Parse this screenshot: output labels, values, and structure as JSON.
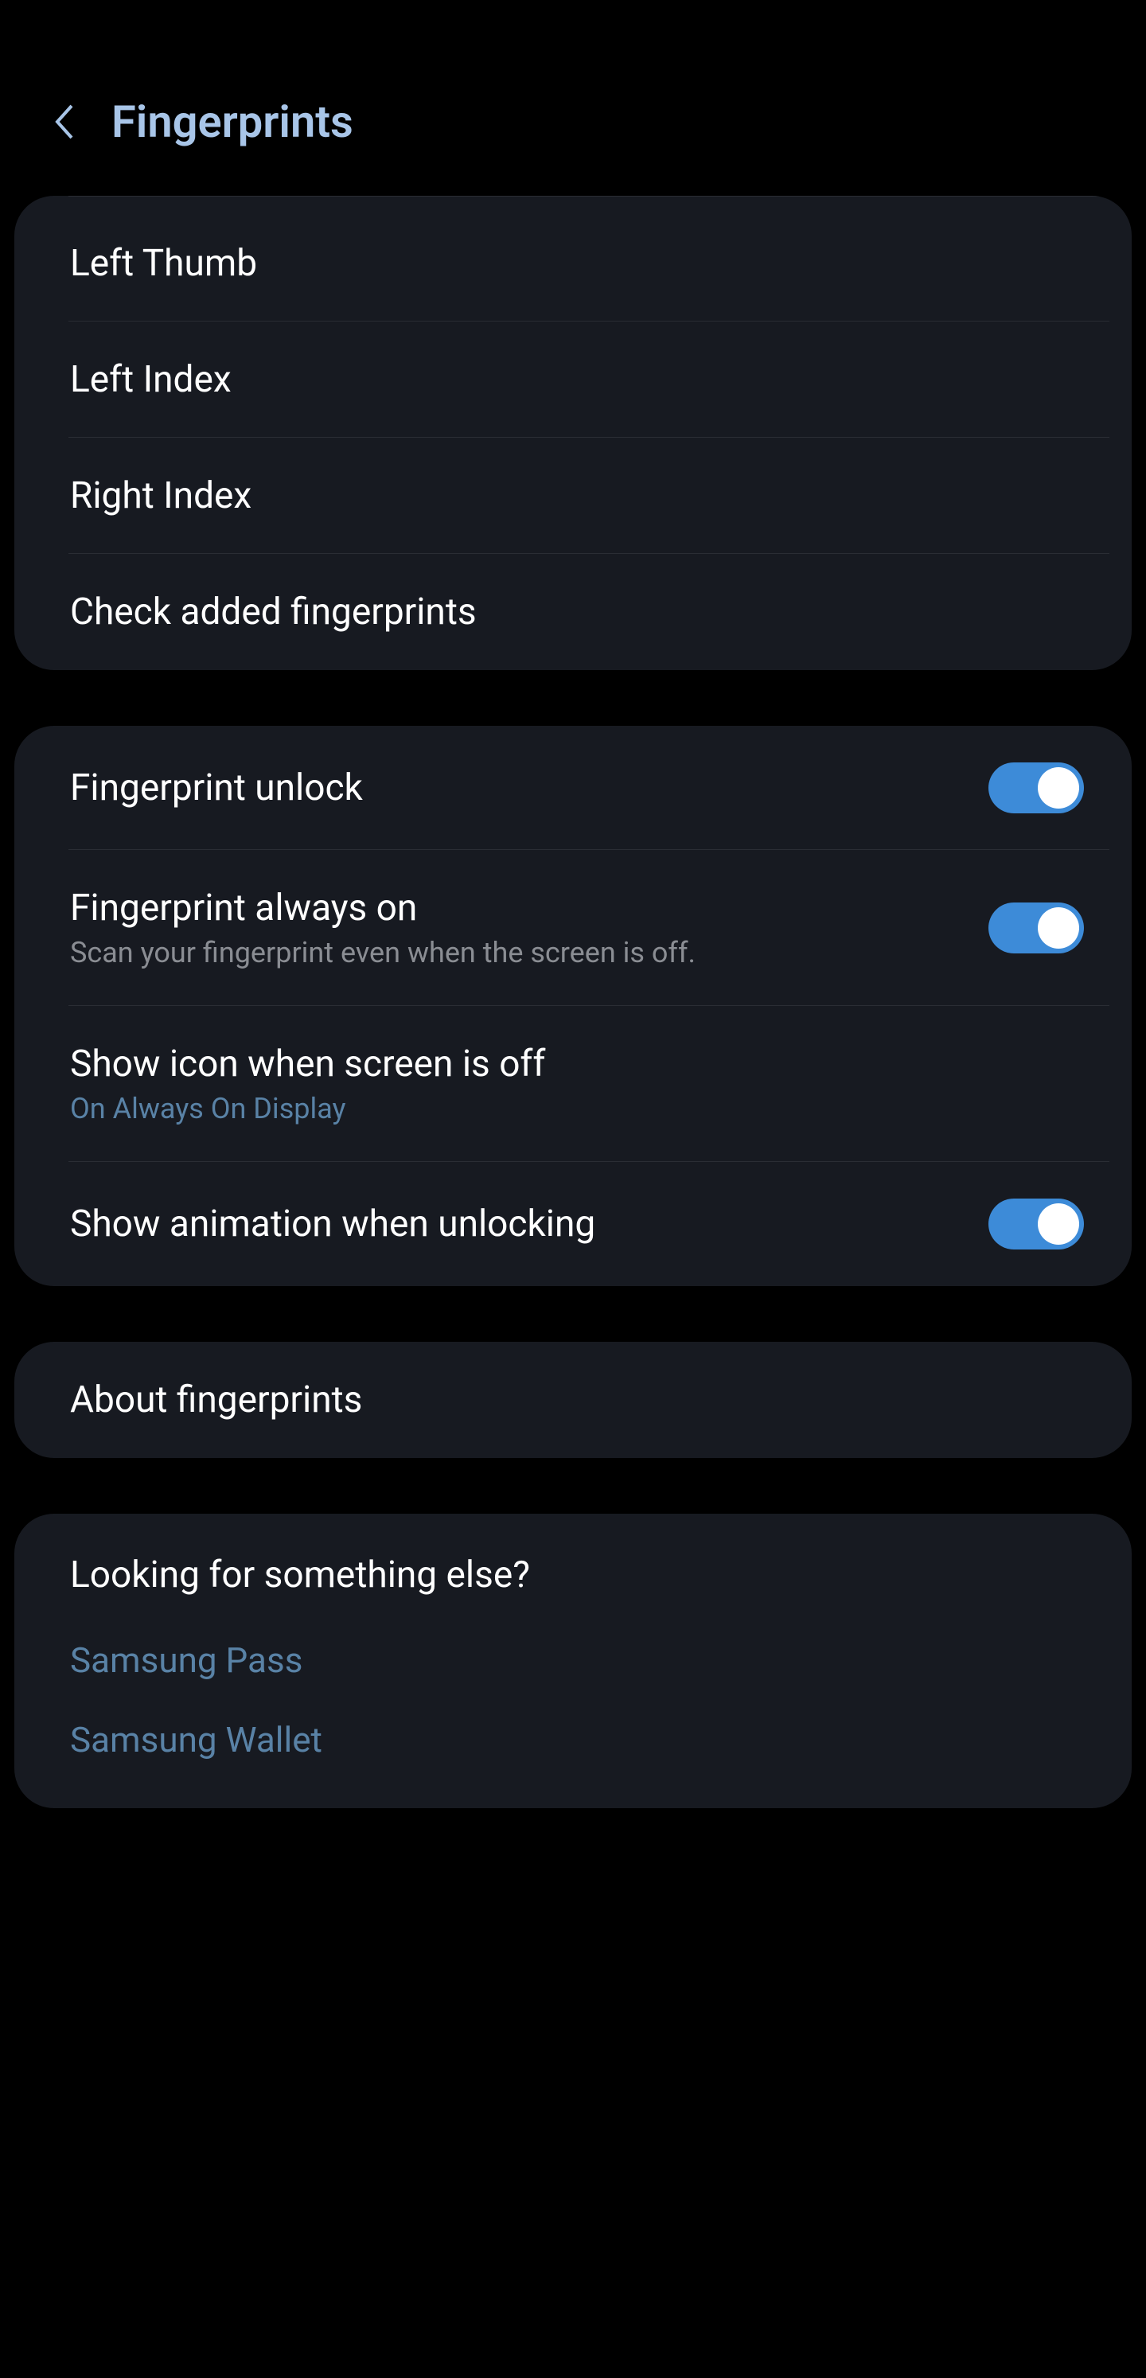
{
  "header": {
    "title": "Fingerprints"
  },
  "fingerprints_list": {
    "items": [
      {
        "label": "Left Thumb"
      },
      {
        "label": "Left Index"
      },
      {
        "label": "Right Index"
      }
    ],
    "check": "Check added fingerprints"
  },
  "settings": {
    "unlock": {
      "label": "Fingerprint unlock",
      "on": true
    },
    "always_on": {
      "label": "Fingerprint always on",
      "sublabel": "Scan your fingerprint even when the screen is off.",
      "on": true
    },
    "show_icon": {
      "label": "Show icon when screen is off",
      "sublabel": "On Always On Display"
    },
    "animation": {
      "label": "Show animation when unlocking",
      "on": true
    }
  },
  "about": {
    "label": "About fingerprints"
  },
  "looking": {
    "header": "Looking for something else?",
    "links": [
      "Samsung Pass",
      "Samsung Wallet"
    ]
  }
}
